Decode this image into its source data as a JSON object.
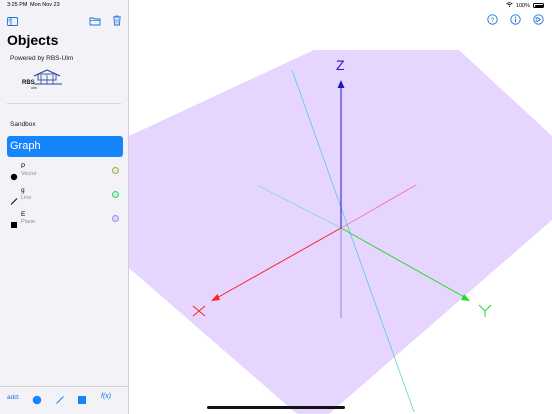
{
  "status": {
    "time": "3:25 PM",
    "date": "Mon Nov 23",
    "battery": "100%"
  },
  "sidebar": {
    "title": "Objects",
    "powered_by": "Powered by RBS-Ulm",
    "logo_text": "RBS ulm",
    "section": "Sandbox",
    "active_item": "Graph",
    "objects": [
      {
        "name": "P",
        "type": "Vector",
        "color": "#a8a66a"
      },
      {
        "name": "g",
        "type": "Line",
        "color": "#3ccf7a"
      },
      {
        "name": "E",
        "type": "Plane",
        "color": "#9b8cf0"
      }
    ],
    "add_label": "add:",
    "function_label": "f(x)"
  },
  "scene": {
    "axis_z_label": "Z",
    "plane_color": "#e6d5ff",
    "axis_colors": {
      "x": "#ff2020",
      "y": "#22dd22",
      "z": "#1a1acc"
    },
    "line_g_color": "#44cccc",
    "accent": "#1585fb"
  }
}
